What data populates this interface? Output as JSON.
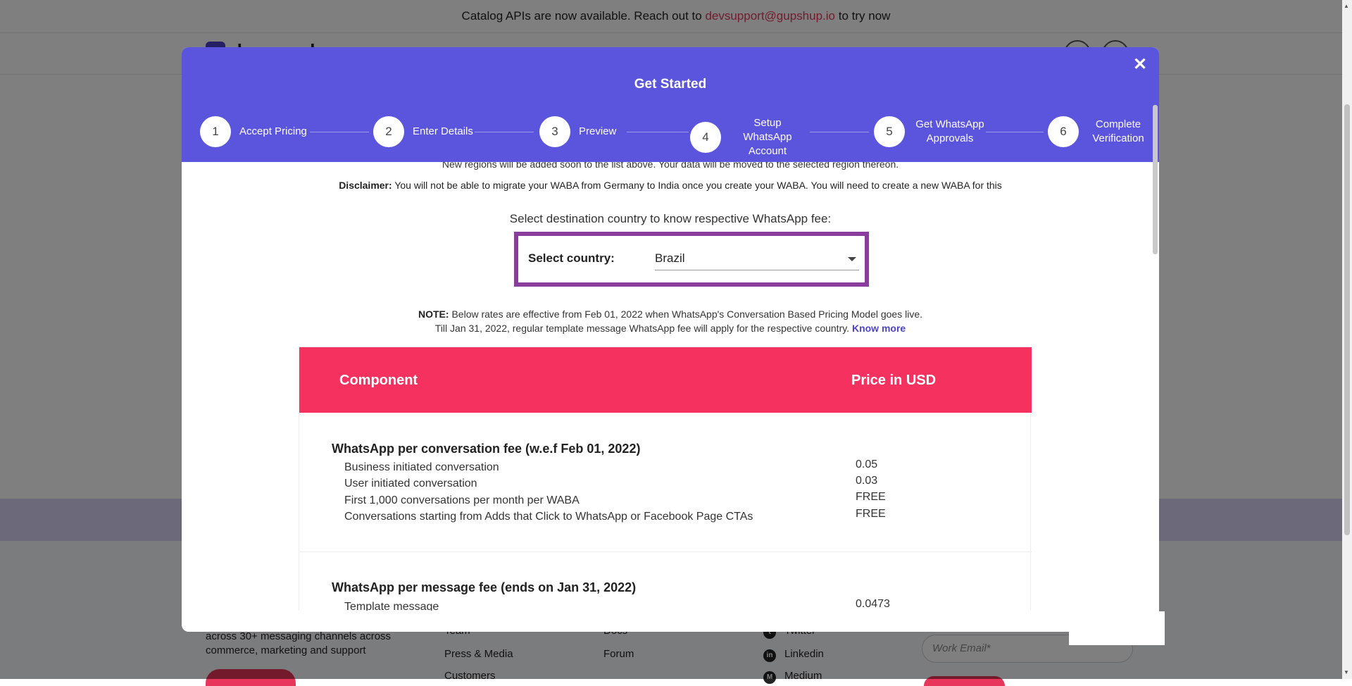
{
  "banner": {
    "prefix": "Catalog APIs are now available. Reach out to",
    "email": "devsupport@gupshup.io",
    "suffix": "to try now"
  },
  "background": {
    "logo_text": "dev.gupshup",
    "footer_tagline": "across 30+ messaging channels across commerce, marketing and support",
    "footer_col1": [
      "Team",
      "Press & Media",
      "Customers"
    ],
    "footer_col2": [
      "Docs",
      "Forum"
    ],
    "footer_social": [
      "Twitter",
      "Linkedin",
      "Medium"
    ],
    "email_placeholder": "Work Email*"
  },
  "modal": {
    "title": "Get Started",
    "close_label": "✕",
    "steps": [
      {
        "num": "1",
        "label": "Accept Pricing",
        "active": true
      },
      {
        "num": "2",
        "label": "Enter Details"
      },
      {
        "num": "3",
        "label": "Preview"
      },
      {
        "num": "4",
        "label": "Setup WhatsApp Account"
      },
      {
        "num": "5",
        "label": "Get WhatsApp Approvals"
      },
      {
        "num": "6",
        "label": "Complete Verification"
      }
    ],
    "region_note": "New regions will be added soon to the list above. Your data will be moved to the selected region thereon.",
    "disclaimer_label": "Disclaimer:",
    "disclaimer_text": "You will not be able to migrate your WABA from Germany to India once you create your WABA. You will need to create a new WABA for this",
    "select_prompt": "Select destination country to know respective WhatsApp fee:",
    "country_label": "Select country:",
    "country_value": "Brazil",
    "note_label": "NOTE:",
    "note_line1": "Below rates are effective from Feb 01, 2022 when WhatsApp's Conversation Based Pricing Model goes live.",
    "note_line2": "Till Jan 31, 2022, regular template message WhatsApp fee will apply for the respective country.",
    "know_more": "Know more",
    "table": {
      "col_component": "Component",
      "col_price": "Price in USD",
      "groups": [
        {
          "title": "WhatsApp per conversation fee (w.e.f Feb 01, 2022)",
          "rows": [
            {
              "label": "Business initiated conversation",
              "price": "0.05"
            },
            {
              "label": "User initiated conversation",
              "price": "0.03"
            },
            {
              "label": "First 1,000 conversations per month per WABA",
              "price": "FREE"
            },
            {
              "label": "Conversations starting from Adds that Click to WhatsApp or Facebook Page CTAs",
              "price": "FREE"
            }
          ]
        },
        {
          "title": "WhatsApp per message fee (ends on Jan 31, 2022)",
          "rows": [
            {
              "label": "Template message",
              "price": "0.0473"
            }
          ]
        }
      ]
    }
  }
}
